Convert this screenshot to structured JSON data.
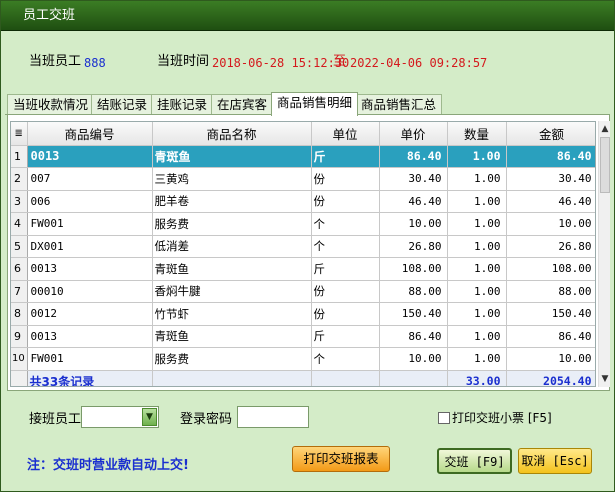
{
  "window": {
    "title": "员工交班"
  },
  "info": {
    "staff_label": "当班员工",
    "staff_value": "888",
    "time_label": "当班时间",
    "start_time": "2018-06-28 15:12:30",
    "to_label": "至",
    "end_time": "2022-04-06 09:28:57"
  },
  "tabs": [
    {
      "label": "当班收款情况"
    },
    {
      "label": "结账记录"
    },
    {
      "label": "挂账记录"
    },
    {
      "label": "在店宾客"
    },
    {
      "label": "商品销售明细",
      "active": true
    },
    {
      "label": "商品销售汇总"
    }
  ],
  "table": {
    "columns": [
      "≣",
      "商品编号",
      "商品名称",
      "单位",
      "单价",
      "数量",
      "金额"
    ],
    "rows": [
      [
        "1",
        "0013",
        "青斑鱼",
        "斤",
        "86.40",
        "1.00",
        "86.40"
      ],
      [
        "2",
        "007",
        "三黄鸡",
        "份",
        "30.40",
        "1.00",
        "30.40"
      ],
      [
        "3",
        "006",
        "肥羊卷",
        "份",
        "46.40",
        "1.00",
        "46.40"
      ],
      [
        "4",
        "FW001",
        "服务费",
        "个",
        "10.00",
        "1.00",
        "10.00"
      ],
      [
        "5",
        "DX001",
        "低消差",
        "个",
        "26.80",
        "1.00",
        "26.80"
      ],
      [
        "6",
        "0013",
        "青斑鱼",
        "斤",
        "108.00",
        "1.00",
        "108.00"
      ],
      [
        "7",
        "00010",
        "香焖牛腱",
        "份",
        "88.00",
        "1.00",
        "88.00"
      ],
      [
        "8",
        "0012",
        "竹节虾",
        "份",
        "150.40",
        "1.00",
        "150.40"
      ],
      [
        "9",
        "0013",
        "青斑鱼",
        "斤",
        "86.40",
        "1.00",
        "86.40"
      ],
      [
        "10",
        "FW001",
        "服务费",
        "个",
        "10.00",
        "1.00",
        "10.00"
      ]
    ],
    "selected_row": 0,
    "footer": {
      "count_text": "共33条记录",
      "qty_total": "33.00",
      "amount_total": "2054.40"
    }
  },
  "bottom": {
    "receiver_label": "接班员工",
    "receiver_value": "",
    "password_label": "登录密码",
    "password_value": "",
    "print_ticket_label": "打印交班小票 [F5]",
    "print_ticket_checked": false,
    "note": "注：交班时营业款自动上交!",
    "print_report_button": "打印交班报表",
    "handover_button": "交班 [F9]",
    "cancel_button": "取消 [Esc]"
  },
  "icons": {
    "scroll_up": "up-arrow-icon",
    "scroll_down": "down-arrow-icon",
    "dropdown": "chevron-down-icon"
  }
}
